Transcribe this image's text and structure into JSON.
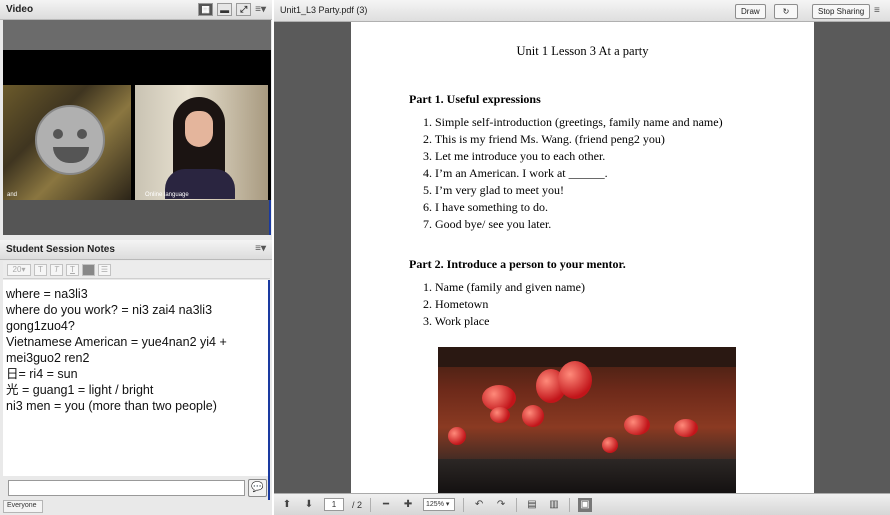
{
  "video_pod": {
    "title": "Video",
    "cam1_label": "and",
    "cam2_label": "Online language"
  },
  "notes_pod": {
    "title": "Student Session Notes",
    "font_size": "20",
    "lines": [
      "where = na3li3",
      "where do you work? = ni3 zai4 na3li3",
      "gong1zuo4?",
      "Vietnamese American = yue4nan2 yi4 +",
      "mei3guo2 ren2",
      "日= ri4 = sun",
      "光 = guang1 = light / bright",
      "ni3 men = you (more than two people)"
    ],
    "chat_placeholder": "",
    "recipient_tab": "Everyone"
  },
  "document": {
    "file_name": "Unit1_L3 Party.pdf (3)",
    "draw_label": "Draw",
    "stop_sharing_label": "Stop Sharing",
    "page_title": "Unit 1 Lesson 3 At a party",
    "part1_title": "Part 1. Useful expressions",
    "part1_items": [
      "1.  Simple self-introduction (greetings, family name and name)",
      "2.  This is my friend Ms. Wang.  (friend peng2 you)",
      "3.  Let me introduce you to each other.",
      "4.  I’m an American. I work at ______.",
      "5.  I’m very glad to meet you!",
      "6.  I have something to do.",
      "7.  Good bye/ see you later."
    ],
    "part2_title": "Part 2.  Introduce a person to your mentor.",
    "part2_items": [
      "1.  Name (family and given name)",
      "2.  Hometown",
      "3.  Work place"
    ],
    "current_page": "1",
    "total_pages": "/ 2",
    "zoom": "125%"
  }
}
